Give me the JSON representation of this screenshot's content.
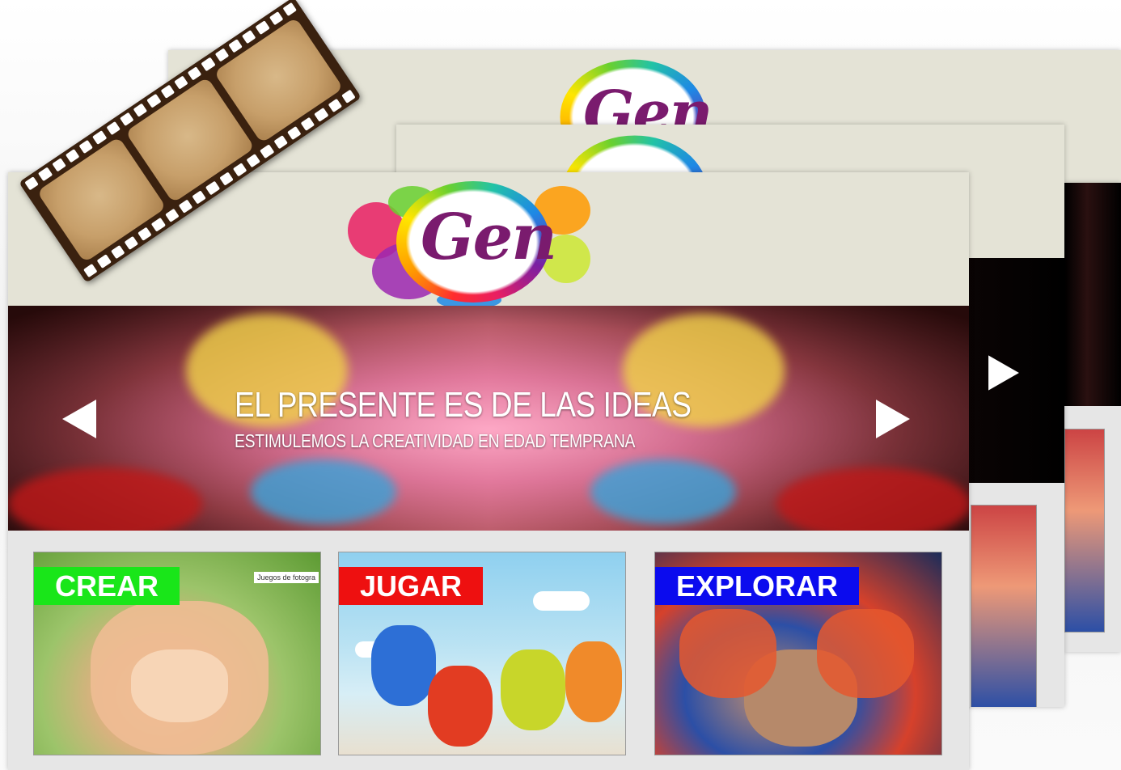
{
  "logo": {
    "text": "Gen"
  },
  "hero": {
    "title": "EL PRESENTE ES DE LAS IDEAS",
    "subtitle": "ESTIMULEMOS LA CREATIVIDAD EN EDAD TEMPRANA"
  },
  "cards": [
    {
      "label": "CREAR",
      "color": "#19e619",
      "tag": "Juegos de fotogra"
    },
    {
      "label": "JUGAR",
      "color": "#ee1010"
    },
    {
      "label": "EXPLORAR",
      "color": "#0b0bee"
    }
  ],
  "colors": {
    "header_band": "#e4e3d6",
    "content_bg": "#e6e6e6",
    "logo_text": "#7a1b6e"
  }
}
